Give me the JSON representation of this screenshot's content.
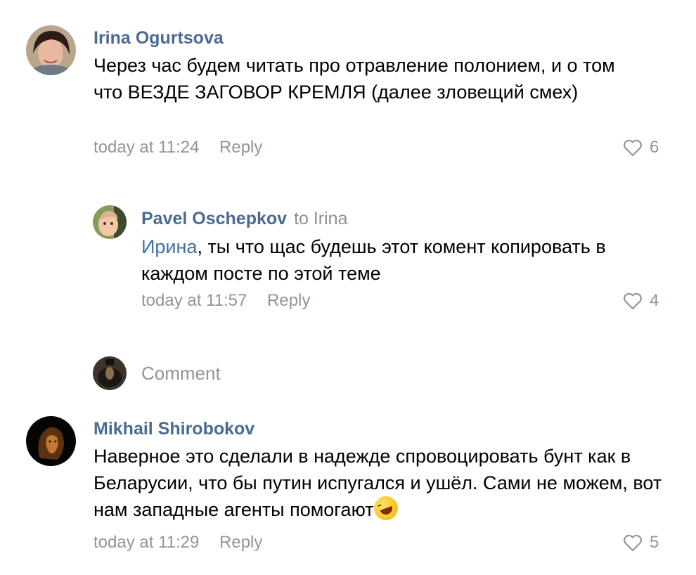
{
  "comments": [
    {
      "author": "Irina Ogurtsova",
      "text": "Через час будем читать про отравление полонием, и о том что ВЕЗДЕ ЗАГОВОР КРЕМЛЯ (далее зловещий смех)",
      "time": "today at 11:24",
      "reply_label": "Reply",
      "likes": "6"
    },
    {
      "author": "Pavel Oschepkov",
      "to": "to Irina",
      "mention": "Ирина",
      "text": ", ты что щас будешь этот комент копировать в каждом посте по этой теме",
      "time": "today at 11:57",
      "reply_label": "Reply",
      "likes": "4"
    },
    {
      "author": "Mikhail Shirobokov",
      "text": "Наверное это сделали в надежде спровоцировать бунт как в Беларусии, что бы путин испугался и ушёл. Сами не можем, вот нам западные агенты помогают",
      "time": "today at 11:29",
      "reply_label": "Reply",
      "likes": "5"
    }
  ],
  "comment_button": {
    "label": "Comment"
  },
  "icons": {
    "like": "heart-outline-icon",
    "emoji": "rolling-on-floor-laughing-emoji"
  },
  "colors": {
    "author": "#4a6a92",
    "meta": "#8f959b",
    "mention": "#3f6fa3"
  }
}
